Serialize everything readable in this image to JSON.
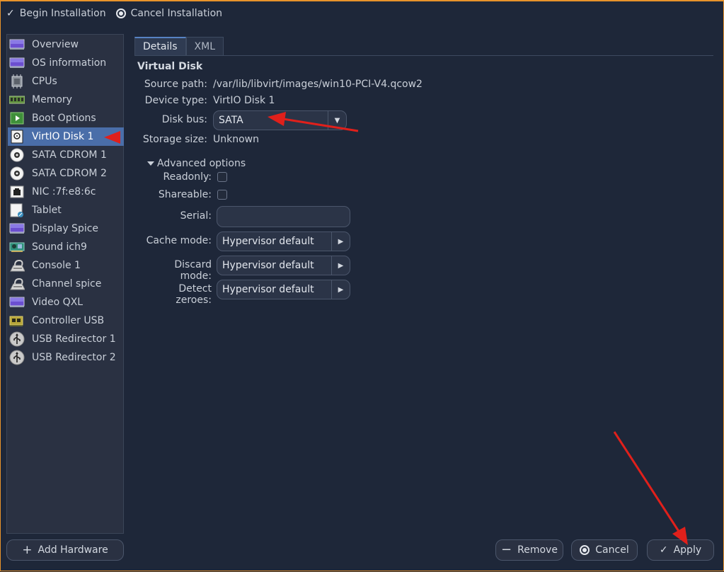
{
  "toolbar": {
    "begin_label": "Begin Installation",
    "cancel_label": "Cancel Installation"
  },
  "sidebar": {
    "items": [
      {
        "label": "Overview",
        "icon": "monitor-icon"
      },
      {
        "label": "OS information",
        "icon": "monitor-icon"
      },
      {
        "label": "CPUs",
        "icon": "cpu-icon"
      },
      {
        "label": "Memory",
        "icon": "memory-icon"
      },
      {
        "label": "Boot Options",
        "icon": "boot-icon"
      },
      {
        "label": "VirtIO Disk 1",
        "icon": "disk-icon",
        "selected": true
      },
      {
        "label": "SATA CDROM 1",
        "icon": "cdrom-icon"
      },
      {
        "label": "SATA CDROM 2",
        "icon": "cdrom-icon"
      },
      {
        "label": "NIC :7f:e8:6c",
        "icon": "network-icon"
      },
      {
        "label": "Tablet",
        "icon": "tablet-icon"
      },
      {
        "label": "Display Spice",
        "icon": "display-icon"
      },
      {
        "label": "Sound ich9",
        "icon": "sound-card-icon"
      },
      {
        "label": "Console 1",
        "icon": "serial-icon"
      },
      {
        "label": "Channel spice",
        "icon": "serial-icon"
      },
      {
        "label": "Video QXL",
        "icon": "video-icon"
      },
      {
        "label": "Controller USB",
        "icon": "controller-icon"
      },
      {
        "label": "USB Redirector 1",
        "icon": "usb-icon"
      },
      {
        "label": "USB Redirector 2",
        "icon": "usb-icon"
      }
    ]
  },
  "add_hardware_label": "Add Hardware",
  "tabs": [
    {
      "label": "Details",
      "active": true
    },
    {
      "label": "XML",
      "active": false
    }
  ],
  "disk": {
    "section_title": "Virtual Disk",
    "source_path_label": "Source path:",
    "source_path_value": "/var/lib/libvirt/images/win10-PCI-V4.qcow2",
    "device_type_label": "Device type:",
    "device_type_value": "VirtIO Disk 1",
    "disk_bus_label": "Disk bus:",
    "disk_bus_value": "SATA",
    "storage_size_label": "Storage size:",
    "storage_size_value": "Unknown"
  },
  "advanced": {
    "toggle_label": "Advanced options",
    "readonly_label": "Readonly:",
    "readonly_checked": false,
    "shareable_label": "Shareable:",
    "shareable_checked": false,
    "serial_label": "Serial:",
    "serial_value": "",
    "cache_mode_label": "Cache mode:",
    "cache_mode_value": "Hypervisor default",
    "discard_mode_label": "Discard mode:",
    "discard_mode_value": "Hypervisor default",
    "detect_zeroes_label": "Detect zeroes:",
    "detect_zeroes_value": "Hypervisor default"
  },
  "buttons": {
    "remove_label": "Remove",
    "cancel_label": "Cancel",
    "apply_label": "Apply"
  },
  "colors": {
    "background": "#1e2739",
    "selection": "#4a6ea9",
    "frame_accent": "#e8932b",
    "annotation_arrow": "#e0201b"
  }
}
